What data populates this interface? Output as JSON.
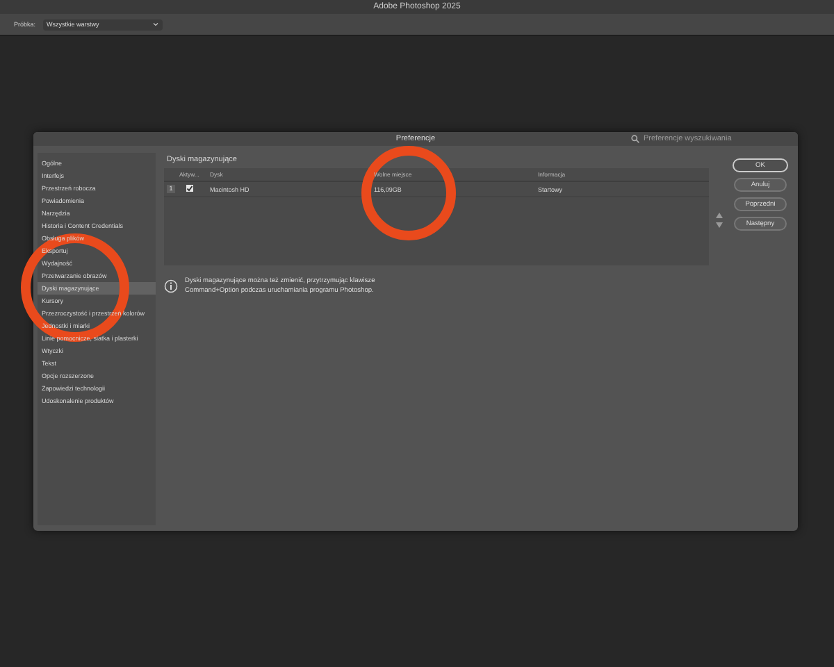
{
  "app_title": "Adobe Photoshop 2025",
  "options_bar": {
    "label": "Próbka:",
    "dropdown": "Wszystkie warstwy"
  },
  "dialog": {
    "title": "Preferencje",
    "search": {
      "placeholder": "Preferencje wyszukiwania"
    }
  },
  "sidebar": {
    "items": [
      {
        "label": "Ogólne",
        "selected": false,
        "circled": false
      },
      {
        "label": "Interfejs",
        "selected": false,
        "circled": false
      },
      {
        "label": "Przestrzeń robocza",
        "selected": false,
        "circled": false
      },
      {
        "label": "Powiadomienia",
        "selected": false,
        "circled": false
      },
      {
        "label": "Narzędzia",
        "selected": false,
        "circled": false
      },
      {
        "label": "Historia i Content Credentials",
        "selected": false,
        "circled": false
      },
      {
        "label": "Obsługa plików",
        "selected": false,
        "circled": false
      },
      {
        "label": "Eksportuj",
        "selected": false,
        "circled": false
      },
      {
        "label": "Wydajność",
        "selected": false,
        "circled": false
      },
      {
        "label": "Przetwarzanie obrazów",
        "selected": false,
        "circled": false
      },
      {
        "label": "Dyski magazynujące",
        "selected": true,
        "circled": true
      },
      {
        "label": "Kursory",
        "selected": false,
        "circled": false
      },
      {
        "label": "Przezroczystość i przestrzeń kolorów",
        "selected": false,
        "circled": false
      },
      {
        "label": "Jednostki i miarki",
        "selected": false,
        "circled": false
      },
      {
        "label": "Linie pomocnicze, siatka i plasterki",
        "selected": false,
        "circled": false
      },
      {
        "label": "Wtyczki",
        "selected": false,
        "circled": false
      },
      {
        "label": "Tekst",
        "selected": false,
        "circled": false
      },
      {
        "label": "Opcje rozszerzone",
        "selected": false,
        "circled": false
      },
      {
        "label": "Zapowiedzi technologii",
        "selected": false,
        "circled": false
      },
      {
        "label": "Udoskonalenie produktów",
        "selected": false,
        "circled": false
      }
    ]
  },
  "section_title": "Dyski magazynujące",
  "table": {
    "columns": [
      {
        "label": "Aktyw...",
        "circled": false
      },
      {
        "label": "Dysk",
        "circled": false
      },
      {
        "label": "Wolne miejsce",
        "circled": true
      },
      {
        "label": "Informacja",
        "circled": false
      }
    ],
    "rows": [
      {
        "index": "1",
        "active": true,
        "disk": "Macintosh HD",
        "free": "116,09GB",
        "info": "Startowy"
      }
    ]
  },
  "note": "Dyski magazynujące można też zmienić, przytrzymując klawisze Command+Option podczas uruchamiania programu Photoshop.",
  "buttons": [
    {
      "label": "OK",
      "primary": true
    },
    {
      "label": "Anuluj",
      "primary": false
    },
    {
      "label": "Poprzedni",
      "primary": false
    },
    {
      "label": "Następny",
      "primary": false
    }
  ]
}
